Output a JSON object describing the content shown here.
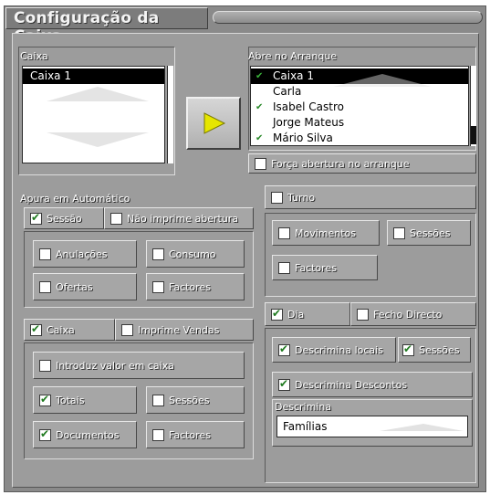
{
  "window": {
    "title": "Configuração da Caixa"
  },
  "caixa": {
    "label": "Caixa",
    "items": [
      {
        "label": "Caixa 1",
        "selected": true
      }
    ]
  },
  "arranque": {
    "label": "Abre no Arranque",
    "items": [
      {
        "label": "Caixa 1",
        "checked": true,
        "selected": true
      },
      {
        "label": "Carla",
        "checked": false,
        "selected": false
      },
      {
        "label": "Isabel Castro",
        "checked": true,
        "selected": false
      },
      {
        "label": "Jorge Mateus",
        "checked": false,
        "selected": false
      },
      {
        "label": "Mário Silva",
        "checked": true,
        "selected": false
      }
    ],
    "force_label": "Força abertura no arranque",
    "force_checked": false
  },
  "transfer_button": {
    "icon": "play-arrow-icon",
    "color": "#e8e800"
  },
  "apura": {
    "label": "Apura em Automático",
    "sessao": {
      "label": "Sessão",
      "checked": true
    },
    "nao_imprime": {
      "label": "Não imprime abertura",
      "checked": false
    },
    "anulacoes": {
      "label": "Anulações",
      "checked": false
    },
    "consumo": {
      "label": "Consumo",
      "checked": false
    },
    "ofertas": {
      "label": "Ofertas",
      "checked": false
    },
    "factores": {
      "label": "Factores",
      "checked": false
    },
    "caixa": {
      "label": "Caixa",
      "checked": true
    },
    "imprime_vendas": {
      "label": "Imprime Vendas",
      "checked": false
    },
    "introduz_valor": {
      "label": "Introduz valor em caixa",
      "checked": false
    },
    "totais": {
      "label": "Totais",
      "checked": true
    },
    "sessoes": {
      "label": "Sessões",
      "checked": false
    },
    "documentos": {
      "label": "Documentos",
      "checked": true
    },
    "factores2": {
      "label": "Factores",
      "checked": false
    }
  },
  "turno": {
    "label": "Turno",
    "checked": false,
    "movimentos": {
      "label": "Movimentos",
      "checked": false
    },
    "sessoes": {
      "label": "Sessões",
      "checked": false
    },
    "factores": {
      "label": "Factores",
      "checked": false
    }
  },
  "dia": {
    "label": "Dia",
    "checked": true,
    "fecho_directo": {
      "label": "Fecho Directo",
      "checked": false
    },
    "descrimina_locais": {
      "label": "Descrimina locais",
      "checked": true
    },
    "sessoes": {
      "label": "Sessões",
      "checked": true
    },
    "descrimina_descontos": {
      "label": "Descrimina Descontos",
      "checked": true
    },
    "descrimina_label": "Descrimina",
    "descrimina_value": "Famílias"
  }
}
